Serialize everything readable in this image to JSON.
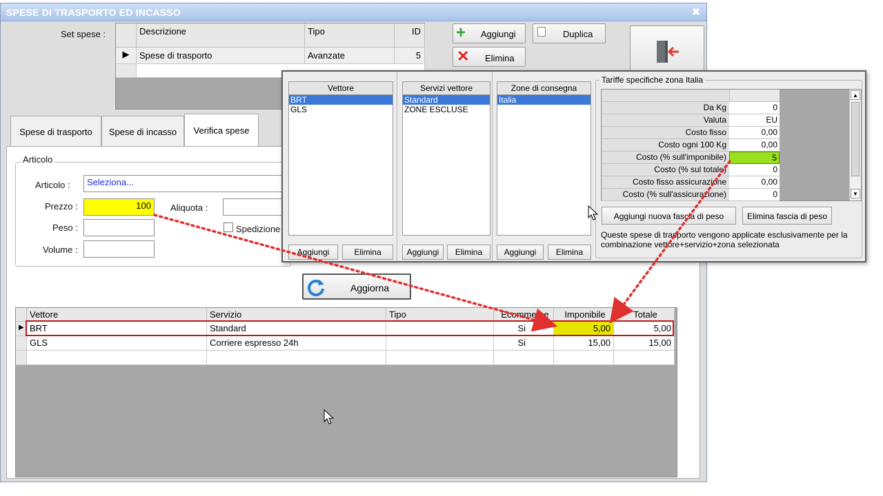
{
  "window": {
    "title": "SPESE DI TRASPORTO ED INCASSO",
    "close_glyph": "✖"
  },
  "set_spese": {
    "label": "Set spese :",
    "columns": [
      "Descrizione",
      "Tipo",
      "ID"
    ],
    "rows": [
      {
        "descrizione": "Spese di trasporto",
        "tipo": "Avanzate",
        "id": "5"
      }
    ]
  },
  "toolbar": {
    "aggiungi": "Aggiungi",
    "duplica": "Duplica",
    "elimina": "Elimina",
    "exit_icon": "exit-door-icon"
  },
  "tabs": [
    "Spese di trasporto",
    "Spese di incasso",
    "Verifica spese"
  ],
  "articolo": {
    "group_label": "Articolo",
    "articolo_label": "Articolo :",
    "articolo_value": "Seleziona...",
    "prezzo_label": "Prezzo :",
    "prezzo_value": "100",
    "aliquota_label": "Aliquota :",
    "peso_label": "Peso :",
    "volume_label": "Volume :",
    "spedizione_label": "Spedizione"
  },
  "aggiorna": "Aggiorna",
  "results": {
    "columns": [
      "Vettore",
      "Servizio",
      "Tipo",
      "Ecommerce",
      "Imponibile",
      "Totale"
    ],
    "rows": [
      {
        "vettore": "BRT",
        "servizio": "Standard",
        "tipo": "",
        "ecommerce": "Si",
        "imponibile": "5,00",
        "totale": "5,00"
      },
      {
        "vettore": "GLS",
        "servizio": "Corriere espresso 24h",
        "tipo": "",
        "ecommerce": "Si",
        "imponibile": "15,00",
        "totale": "15,00"
      }
    ]
  },
  "popup": {
    "vettore_header": "Vettore",
    "vettori": [
      "BRT",
      "GLS"
    ],
    "servizi_header": "Servizi vettore",
    "servizi": [
      "Standard",
      "ZONE ESCLUSE"
    ],
    "zone_header": "Zone di consegna",
    "zone": [
      "Italia"
    ],
    "btn_aggiungi": "Aggiungi",
    "btn_elimina": "Elimina",
    "tariffe_label": "Tariffe specifiche zona Italia",
    "tariffe": [
      {
        "label": "Da Kg",
        "value": "0"
      },
      {
        "label": "Valuta",
        "value": "EU"
      },
      {
        "label": "Costo fisso",
        "value": "0,00"
      },
      {
        "label": "Costo ogni 100 Kg",
        "value": "0,00"
      },
      {
        "label": "Costo (% sull'imponibile)",
        "value": "5"
      },
      {
        "label": "Costo (% sul totale)",
        "value": "0"
      },
      {
        "label": "Costo fisso assicurazione",
        "value": "0,00"
      },
      {
        "label": "Costo (% sull'assicurazione)",
        "value": "0"
      }
    ],
    "aggiungi_fascia": "Aggiungi nuova fascia di peso",
    "elimina_fascia": "Elimina fascia di peso",
    "note": "Queste spese di trasporto vengono applicate esclusivamente per la combinazione vettore+servizio+zona selezionata"
  },
  "colors": {
    "highlight_yellow": "#ffff00",
    "highlight_green": "#9be01e",
    "annotation_red": "#e03030",
    "selection_blue": "#3b78d8"
  }
}
